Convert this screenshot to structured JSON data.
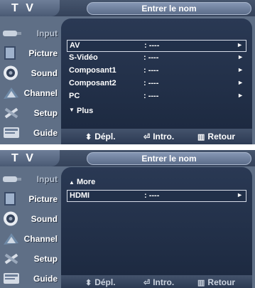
{
  "screen1": {
    "tv_label": "T V",
    "title": "Entrer le nom",
    "sidebar": [
      {
        "label": "Input",
        "dim": true
      },
      {
        "label": "Picture",
        "dim": false
      },
      {
        "label": "Sound",
        "dim": false
      },
      {
        "label": "Channel",
        "dim": false
      },
      {
        "label": "Setup",
        "dim": false
      },
      {
        "label": "Guide",
        "dim": false
      }
    ],
    "rows": [
      {
        "label": "AV",
        "value": ": ----",
        "selected": true
      },
      {
        "label": "S-Vidéo",
        "value": ": ----",
        "selected": false
      },
      {
        "label": "Composant1",
        "value": ": ----",
        "selected": false
      },
      {
        "label": "Composant2",
        "value": ": ----",
        "selected": false
      },
      {
        "label": "PC",
        "value": ": ----",
        "selected": false
      }
    ],
    "more_label": "Plus",
    "footer": {
      "move": "Dépl.",
      "enter": "Intro.",
      "return": "Retour"
    }
  },
  "screen2": {
    "tv_label": "T V",
    "title": "Entrer le nom",
    "sidebar": [
      {
        "label": "Input",
        "dim": true
      },
      {
        "label": "Picture",
        "dim": false
      },
      {
        "label": "Sound",
        "dim": false
      },
      {
        "label": "Channel",
        "dim": false
      },
      {
        "label": "Setup",
        "dim": false
      },
      {
        "label": "Guide",
        "dim": false
      }
    ],
    "more_label": "More",
    "rows": [
      {
        "label": "HDMI",
        "value": ": ----",
        "selected": true
      }
    ],
    "footer": {
      "move": "Dépl.",
      "enter": "Intro.",
      "return": "Retour"
    }
  },
  "icons": {
    "up": "▲",
    "down": "▼",
    "right": "►",
    "updown": "⬍",
    "enter": "⏎",
    "return": "▥"
  }
}
